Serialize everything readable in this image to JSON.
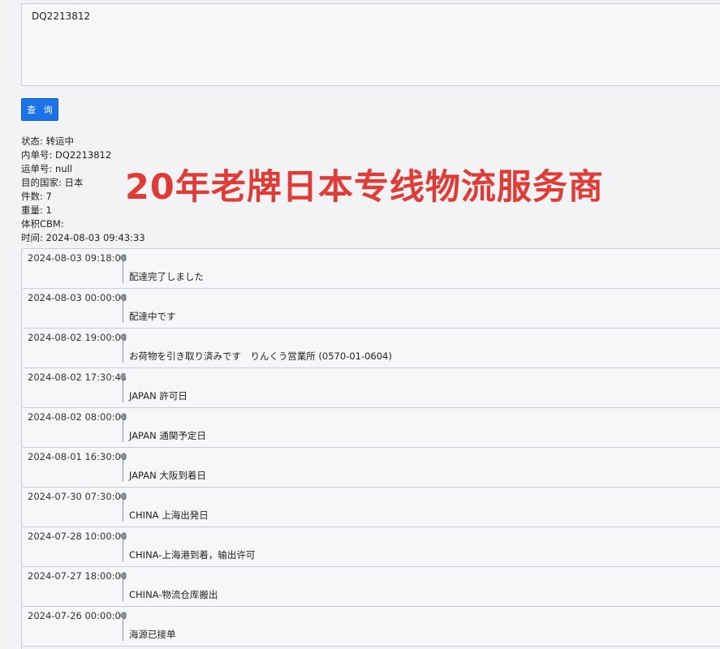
{
  "query": {
    "value": "DQ2213812"
  },
  "search_button": {
    "label": "查 询"
  },
  "info": [
    {
      "label": "状态:",
      "value": "转运中"
    },
    {
      "label": "内单号:",
      "value": "DQ2213812"
    },
    {
      "label": "运单号:",
      "value": "null"
    },
    {
      "label": "目的国家:",
      "value": "日本"
    },
    {
      "label": "件数:",
      "value": "7"
    },
    {
      "label": "重量:",
      "value": "1"
    },
    {
      "label": "体积CBM:",
      "value": ""
    },
    {
      "label": "时间:",
      "value": "2024-08-03 09:43:33"
    }
  ],
  "banner": {
    "text": "20年老牌日本专线物流服务商"
  },
  "timeline": [
    {
      "date": "2024-08-03 09:18:00",
      "desc": "配達完了しました"
    },
    {
      "date": "2024-08-03 00:00:00",
      "desc": "配達中です"
    },
    {
      "date": "2024-08-02 19:00:00",
      "desc": "お荷物を引き取り済みです　りんくう営業所 (0570-01-0604)"
    },
    {
      "date": "2024-08-02 17:30:45",
      "desc": "JAPAN 許可日"
    },
    {
      "date": "2024-08-02 08:00:00",
      "desc": "JAPAN 通関予定日"
    },
    {
      "date": "2024-08-01 16:30:00",
      "desc": "JAPAN 大阪到着日"
    },
    {
      "date": "2024-07-30 07:30:00",
      "desc": "CHINA 上海出発日"
    },
    {
      "date": "2024-07-28 10:00:00",
      "desc": "CHINA-上海港到着，输出许可"
    },
    {
      "date": "2024-07-27 18:00:00",
      "desc": "CHINA-物流仓库搬出"
    },
    {
      "date": "2024-07-26 00:00:00",
      "desc": "海源已接单"
    }
  ]
}
